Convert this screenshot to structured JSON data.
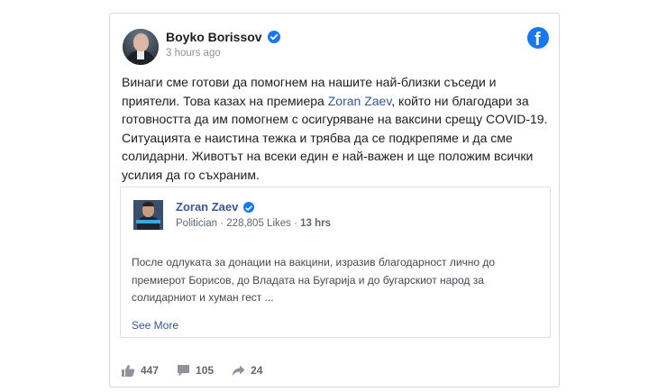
{
  "post": {
    "author": "Boyko Borissov",
    "time": "3 hours ago",
    "text_before": "Винаги сме готови да помогнем на нашите най-близки съседи и приятели. Това казах на премиера ",
    "mention": "Zoran Zaev",
    "text_after": ", който ни благодари за готовността да им помогнем с осигуряване на ваксини срещу COVID-19. Ситуацията е наистина тежка и трябва да се подкрепяме и да сме солидарни. Животът на всеки един е най-важен и ще положим всички усилия да го съхраним.",
    "brand_icon": "facebook-icon",
    "accent_color": "#1877f2"
  },
  "shared": {
    "author": "Zoran Zaev",
    "category": "Politician",
    "likes": "228,805 Likes",
    "time": "13 hrs",
    "separator": "·",
    "text": "После одлуката за донации на вакцини, изразив благодарност лично до премиерот Борисов, до Владата на Бугарија и до бугарскиот народ за солидарниот и хуман гест ...",
    "see_more": "See More"
  },
  "footer": {
    "likes": "447",
    "comments": "105",
    "shares": "24"
  }
}
